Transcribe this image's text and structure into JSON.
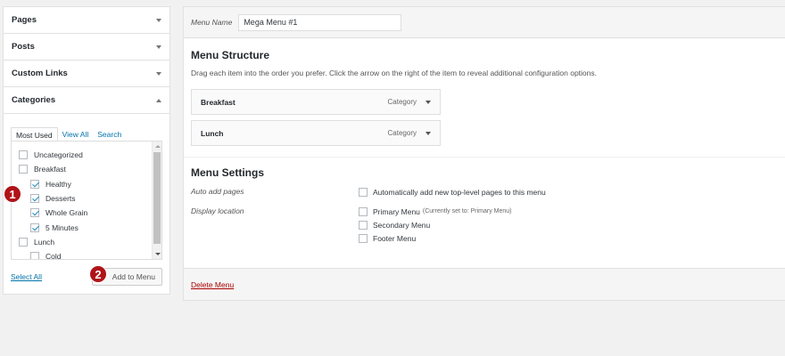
{
  "accordion": {
    "pages": "Pages",
    "posts": "Posts",
    "custom_links": "Custom Links",
    "categories": "Categories"
  },
  "categories_panel": {
    "tabs": [
      "Most Used",
      "View All",
      "Search"
    ],
    "items": [
      {
        "label": "Uncategorized",
        "checked": false,
        "child": false
      },
      {
        "label": "Breakfast",
        "checked": false,
        "child": false
      },
      {
        "label": "Healthy",
        "checked": true,
        "child": true
      },
      {
        "label": "Desserts",
        "checked": true,
        "child": true
      },
      {
        "label": "Whole Grain",
        "checked": true,
        "child": true
      },
      {
        "label": "5 Minutes",
        "checked": true,
        "child": true
      },
      {
        "label": "Lunch",
        "checked": false,
        "child": false
      },
      {
        "label": "Cold",
        "checked": false,
        "child": true
      }
    ],
    "select_all": "Select All",
    "add_to_menu": "Add to Menu"
  },
  "badges": {
    "one": "1",
    "two": "2"
  },
  "menu": {
    "name_label": "Menu Name",
    "name_value": "Mega Menu #1",
    "structure_title": "Menu Structure",
    "structure_desc": "Drag each item into the order you prefer. Click the arrow on the right of the item to reveal additional configuration options.",
    "items": [
      {
        "title": "Breakfast",
        "type": "Category"
      },
      {
        "title": "Lunch",
        "type": "Category"
      }
    ],
    "settings_title": "Menu Settings",
    "auto_add_label": "Auto add pages",
    "auto_add_option": "Automatically add new top-level pages to this menu",
    "display_location_label": "Display location",
    "locations": {
      "primary": "Primary Menu",
      "primary_note": "(Currently set to: Primary Menu)",
      "secondary": "Secondary Menu",
      "footer": "Footer Menu"
    },
    "delete": "Delete Menu"
  },
  "colors": {
    "badge": "#b01318",
    "link": "#0073aa",
    "delete": "#aa0000"
  }
}
